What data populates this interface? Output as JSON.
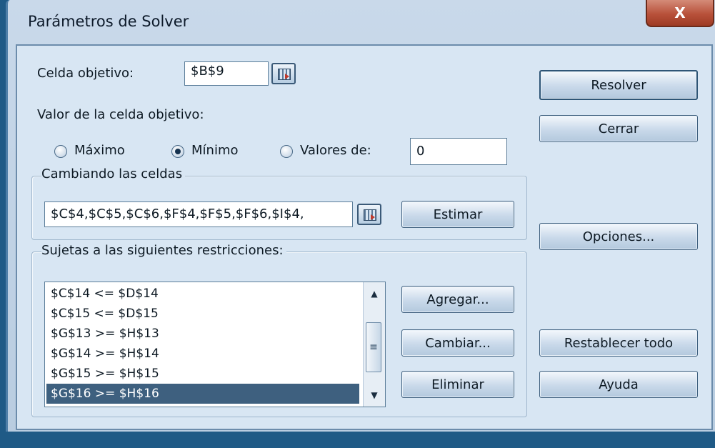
{
  "window": {
    "title": "Parámetros de Solver",
    "close_glyph": "X"
  },
  "target_cell": {
    "label": "Celda objetivo:",
    "value": "$B$9"
  },
  "target_value": {
    "label": "Valor de la celda objetivo:",
    "options": [
      {
        "label": "Máximo",
        "selected": false
      },
      {
        "label": "Mínimo",
        "selected": true
      },
      {
        "label": "Valores de:",
        "selected": false
      }
    ],
    "value_of": "0"
  },
  "changing_cells": {
    "label": "Cambiando las celdas",
    "value": "$C$4,$C$5,$C$6,$F$4,$F$5,$F$6,$I$4,",
    "guess_button": "Estimar"
  },
  "constraints": {
    "label": "Sujetas a las siguientes restricciones:",
    "items": [
      "$C$14 <= $D$14",
      "$C$15 <= $D$15",
      "$G$13 >= $H$13",
      "$G$14 >= $H$14",
      "$G$15 >= $H$15",
      "$G$16 >= $H$16"
    ],
    "selected_index": 5,
    "buttons": {
      "add": "Agregar...",
      "change": "Cambiar...",
      "delete": "Eliminar"
    }
  },
  "side_buttons": {
    "solve": "Resolver",
    "close": "Cerrar",
    "options": "Opciones...",
    "reset": "Restablecer todo",
    "help": "Ayuda"
  }
}
